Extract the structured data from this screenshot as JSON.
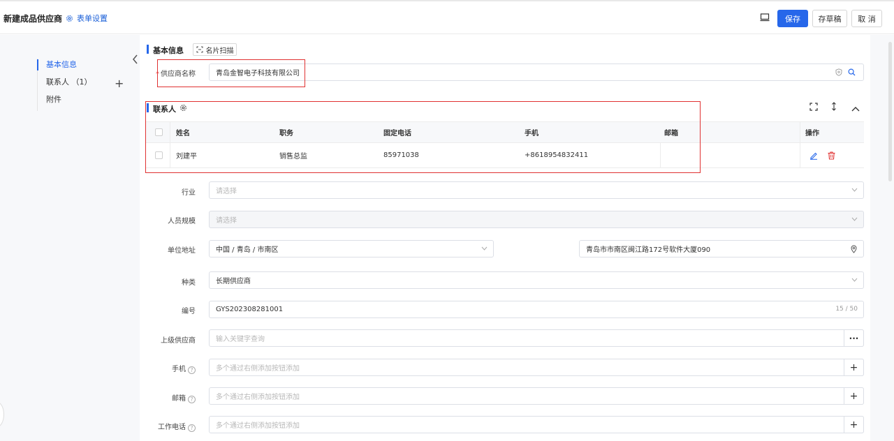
{
  "header": {
    "title": "新建成品供应商",
    "form_settings": "表单设置",
    "save": "保存",
    "draft": "存草稿",
    "cancel": "取 消"
  },
  "nav": {
    "items": [
      {
        "label": "基本信息"
      },
      {
        "label": "联系人 （1）"
      },
      {
        "label": "附件"
      }
    ]
  },
  "basic": {
    "title": "基本信息",
    "scan": "名片扫描",
    "supplier_name_label": "供应商名称",
    "supplier_name": "青岛金智电子科技有限公司"
  },
  "contacts": {
    "title": "联系人",
    "columns": [
      "姓名",
      "职务",
      "固定电话",
      "手机",
      "邮箱",
      "操作"
    ],
    "rows": [
      {
        "name": "刘建平",
        "position": "销售总监",
        "phone": "85971038",
        "mobile": "+8618954832411",
        "email": ""
      }
    ]
  },
  "fields": {
    "industry": {
      "label": "行业",
      "placeholder": "请选择"
    },
    "scale": {
      "label": "人员规模",
      "placeholder": "请选择"
    },
    "address": {
      "label": "单位地址",
      "region": "中国 / 青岛 / 市南区",
      "detail": "青岛市市南区闽江路172号软件大厦090"
    },
    "category": {
      "label": "种类",
      "value": "长期供应商"
    },
    "code": {
      "label": "编号",
      "value": "GYS202308281001",
      "count": "15 / 50"
    },
    "parent": {
      "label": "上级供应商",
      "placeholder": "输入关键字查询",
      "more": "···"
    },
    "mobile": {
      "label": "手机",
      "placeholder": "多个通过右侧添加按钮添加"
    },
    "email": {
      "label": "邮箱",
      "placeholder": "多个通过右侧添加按钮添加"
    },
    "work_phone": {
      "label": "工作电话",
      "placeholder": "多个通过右侧添加按钮添加"
    }
  },
  "colors": {
    "accent": "#2667ea",
    "highlight_box": "#e03131",
    "delete": "#e03131"
  },
  "icons": [
    "gear-icon",
    "monitor-icon",
    "scan-icon",
    "shield-icon",
    "search-icon",
    "location-pin-icon",
    "fullscreen-icon",
    "expand-vertical-icon",
    "collapse-up-icon",
    "edit-icon",
    "delete-icon",
    "plus-icon",
    "chevron-left-icon",
    "chevron-down-icon",
    "help-icon"
  ]
}
